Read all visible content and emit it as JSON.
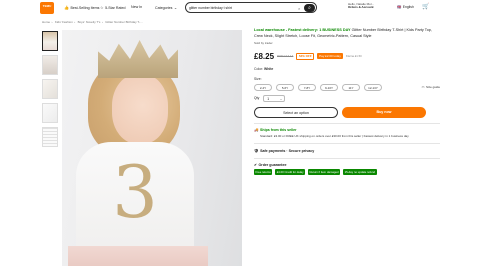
{
  "header": {
    "logo_text": "TEMU",
    "nav": [
      {
        "label": "Best-Selling Items",
        "icon": "thumbs-up-icon"
      },
      {
        "label": "5-Star Rated",
        "icon": "star-icon"
      },
      {
        "label": "New In",
        "icon": "new-icon"
      },
      {
        "label": "Categories",
        "icon": "chevron-down-icon"
      }
    ],
    "search_value": "glitter number birthday t shirt",
    "account_line1": "Hello, Natalie Mor...",
    "account_line2": "Orders & Account",
    "language": "English",
    "icons": {
      "search": "search-icon",
      "clear": "close-icon",
      "cart": "cart-icon",
      "flag": "flag-icon"
    }
  },
  "breadcrumb": [
    "Home",
    "Kids' Fashion",
    "Boys' Novelty T's",
    "Glitter Number Birthday T-..."
  ],
  "product": {
    "delivery_prefix": "Local warehouse - Fastest delivery: 1 BUSINESS DAY",
    "title": "Glitter Number Birthday T-Shirt | Kids Party Top, Crew Neck, Slight Stretch, Loose Fit, Geometric-Pattern, Casual Style",
    "sold_by": "Sold by trader",
    "price": "£8.25",
    "rrp": "RRP £17.14",
    "discount": "53% OFF",
    "promo": "Pay £2.00 today",
    "promo_sub": "Klarna £1.50",
    "color_label": "Color:",
    "color_value": "White",
    "size_label": "Size:",
    "sizes": [
      "2-4Y",
      "5-6Y",
      "7-8Y",
      "9-10Y",
      "11Y",
      "12-13Y"
    ],
    "size_guide": "Size guide",
    "qty_label": "Qty",
    "qty_value": "1",
    "btn_select": "Select an option",
    "btn_buy": "Buy now"
  },
  "shipping": {
    "title": "Ships from this seller",
    "standard": "Standard: £3.00 or FREE UK shipping on orders over £30.00 from this seller | Fastest delivery in 1 business day",
    "payments": "Safe payments · Secure privacy",
    "guarantee": "Order guarantee",
    "tags": [
      "Free returns",
      "£4.00 Credit for delay",
      "Return if item damaged",
      "15-day no update refund"
    ]
  },
  "colors": {
    "accent": "#fb7701",
    "green": "#0a8800"
  }
}
